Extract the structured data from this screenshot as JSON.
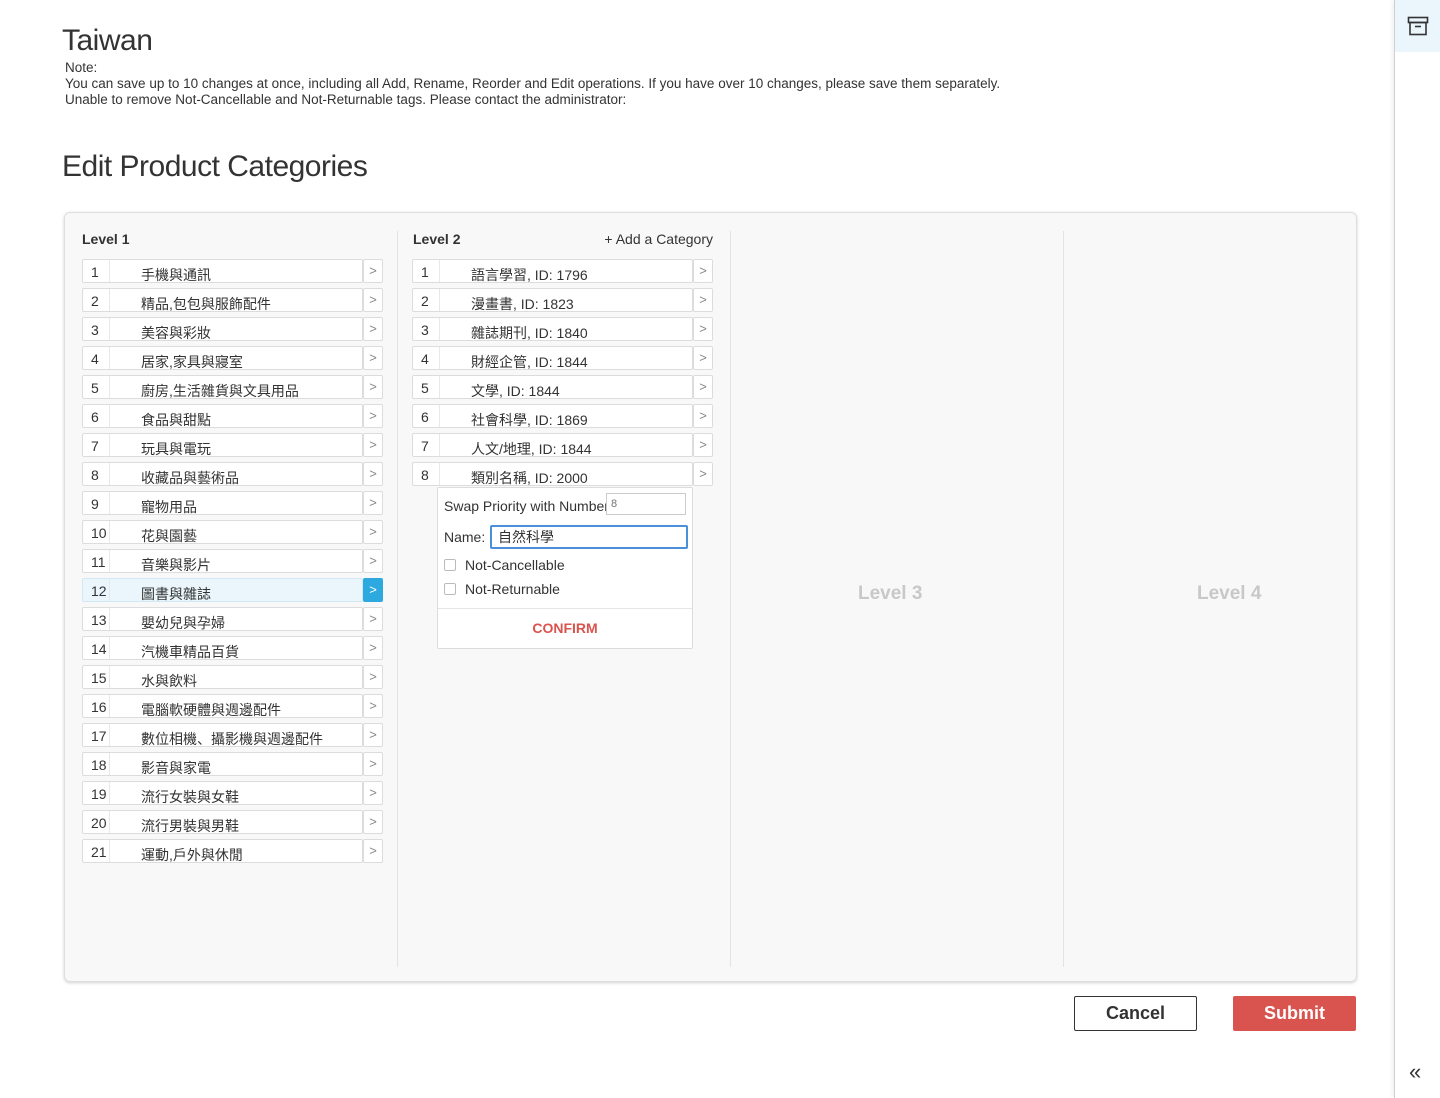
{
  "page": {
    "title": "Taiwan",
    "note_heading": "Note:",
    "note_lines": [
      "You can save up to 10 changes at once, including all Add, Rename, Reorder and Edit operations. If you have over 10 changes, please save them separately.",
      "Unable to remove Not-Cancellable and Not-Returnable tags. Please contact the administrator:"
    ],
    "section_title": "Edit Product Categories"
  },
  "editor": {
    "level1": {
      "title": "Level 1",
      "selected_index": 11,
      "items": [
        {
          "num": "1",
          "label": "手機與通訊"
        },
        {
          "num": "2",
          "label": "精品,包包與服飾配件"
        },
        {
          "num": "3",
          "label": "美容與彩妝"
        },
        {
          "num": "4",
          "label": "居家,家具與寢室"
        },
        {
          "num": "5",
          "label": "廚房,生活雜貨與文具用品"
        },
        {
          "num": "6",
          "label": "食品與甜點"
        },
        {
          "num": "7",
          "label": "玩具與電玩"
        },
        {
          "num": "8",
          "label": "收藏品與藝術品"
        },
        {
          "num": "9",
          "label": "寵物用品"
        },
        {
          "num": "10",
          "label": "花與園藝"
        },
        {
          "num": "11",
          "label": "音樂與影片"
        },
        {
          "num": "12",
          "label": "圖書與雜誌"
        },
        {
          "num": "13",
          "label": "嬰幼兒與孕婦"
        },
        {
          "num": "14",
          "label": "汽機車精品百貨"
        },
        {
          "num": "15",
          "label": "水與飲料"
        },
        {
          "num": "16",
          "label": "電腦軟硬體與週邊配件"
        },
        {
          "num": "17",
          "label": "數位相機、攝影機與週邊配件"
        },
        {
          "num": "18",
          "label": "影音與家電"
        },
        {
          "num": "19",
          "label": "流行女裝與女鞋"
        },
        {
          "num": "20",
          "label": "流行男裝與男鞋"
        },
        {
          "num": "21",
          "label": "運動,戶外與休閒"
        }
      ]
    },
    "level2": {
      "title": "Level 2",
      "add_label": "+ Add a Category",
      "items": [
        {
          "num": "1",
          "label": "語言學習, ID: 1796"
        },
        {
          "num": "2",
          "label": "漫畫書, ID: 1823"
        },
        {
          "num": "3",
          "label": "雜誌期刊, ID: 1840"
        },
        {
          "num": "4",
          "label": "財經企管, ID: 1844"
        },
        {
          "num": "5",
          "label": "文學, ID: 1844"
        },
        {
          "num": "6",
          "label": "社會科學, ID: 1869"
        },
        {
          "num": "7",
          "label": "人文/地理, ID: 1844"
        },
        {
          "num": "8",
          "label": "類別名稱, ID: 2000"
        }
      ]
    },
    "edit_panel": {
      "swap_label": "Swap Priority with Number",
      "swap_placeholder": "8",
      "name_label": "Name:",
      "name_value": "自然科學",
      "not_cancellable_label": "Not-Cancellable",
      "not_cancellable_checked": false,
      "not_returnable_label": "Not-Returnable",
      "not_returnable_checked": false,
      "confirm_label": "CONFIRM"
    },
    "level3": {
      "title": "Level 3"
    },
    "level4": {
      "title": "Level 4"
    }
  },
  "actions": {
    "cancel_label": "Cancel",
    "submit_label": "Submit"
  },
  "sidebar": {
    "top_icon": "archive-box-icon",
    "collapse_icon": "double-chevron-left-icon",
    "collapse_glyph": "«"
  },
  "colors": {
    "accent_blue": "#2ea9df",
    "submit_red": "#d9534f",
    "selected_row_bg": "#eaf6fc",
    "placeholder_gray": "#c8c8c8"
  }
}
